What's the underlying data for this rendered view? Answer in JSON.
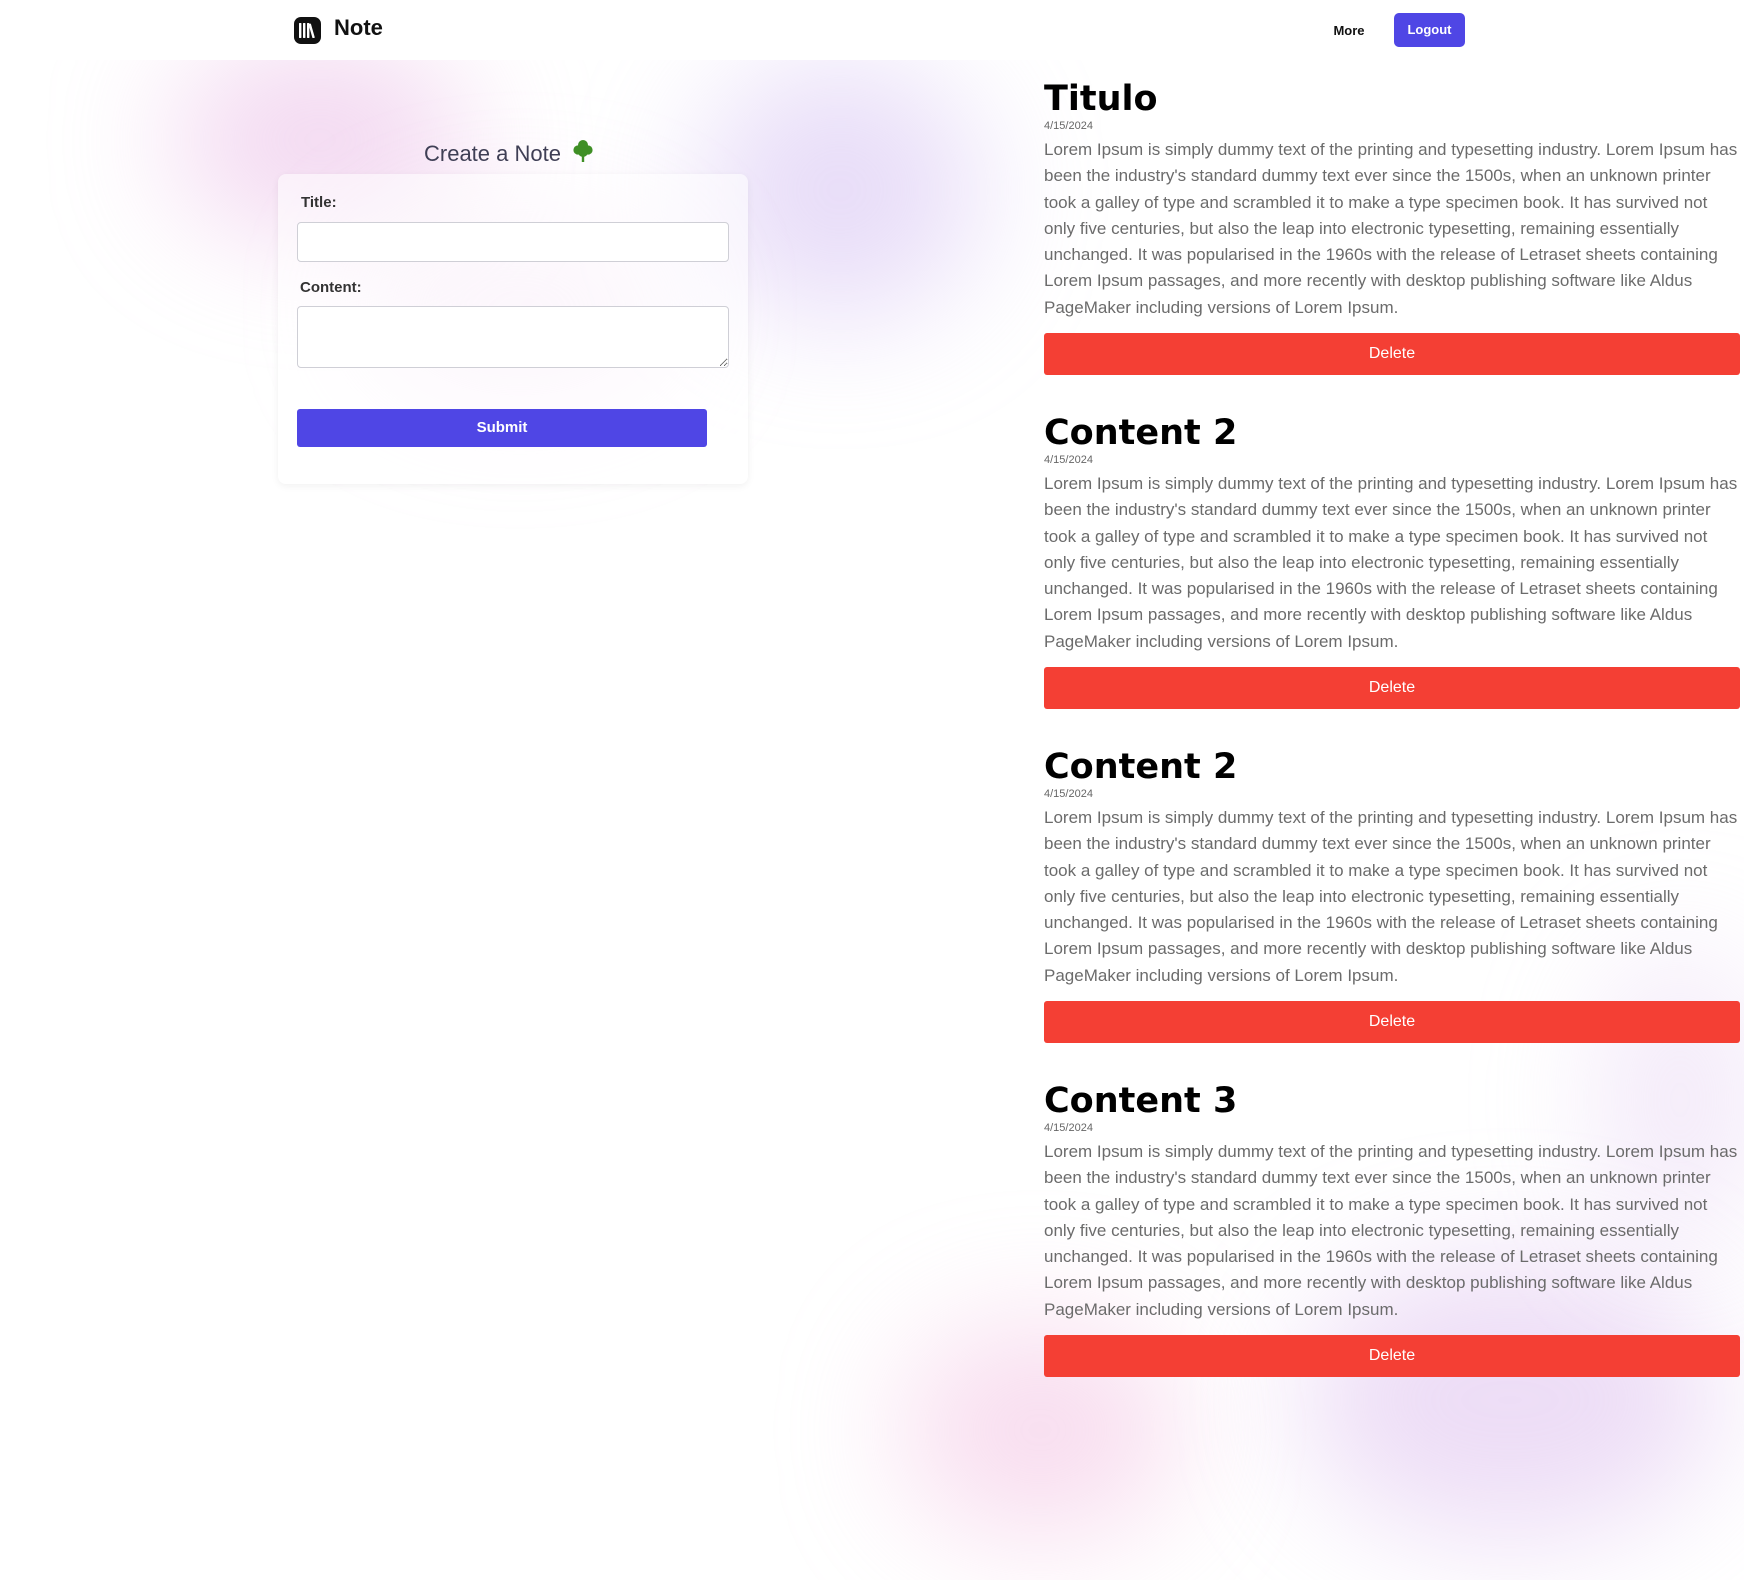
{
  "header": {
    "brand": "Note",
    "more_label": "More",
    "logout_label": "Logout"
  },
  "form": {
    "heading": "Create a Note",
    "title_label": "Title:",
    "content_label": "Content:",
    "title_value": "",
    "content_value": "",
    "submit_label": "Submit"
  },
  "notes": [
    {
      "title": "Titulo",
      "date": "4/15/2024",
      "content": "Lorem Ipsum is simply dummy text of the printing and typesetting industry. Lorem Ipsum has been the industry's standard dummy text ever since the 1500s, when an unknown printer took a galley of type and scrambled it to make a type specimen book. It has survived not only five centuries, but also the leap into electronic typesetting, remaining essentially unchanged. It was popularised in the 1960s with the release of Letraset sheets containing Lorem Ipsum passages, and more recently with desktop publishing software like Aldus PageMaker including versions of Lorem Ipsum.",
      "delete_label": "Delete"
    },
    {
      "title": "Content 2",
      "date": "4/15/2024",
      "content": "Lorem Ipsum is simply dummy text of the printing and typesetting industry. Lorem Ipsum has been the industry's standard dummy text ever since the 1500s, when an unknown printer took a galley of type and scrambled it to make a type specimen book. It has survived not only five centuries, but also the leap into electronic typesetting, remaining essentially unchanged. It was popularised in the 1960s with the release of Letraset sheets containing Lorem Ipsum passages, and more recently with desktop publishing software like Aldus PageMaker including versions of Lorem Ipsum.",
      "delete_label": "Delete"
    },
    {
      "title": "Content 2",
      "date": "4/15/2024",
      "content": "Lorem Ipsum is simply dummy text of the printing and typesetting industry. Lorem Ipsum has been the industry's standard dummy text ever since the 1500s, when an unknown printer took a galley of type and scrambled it to make a type specimen book. It has survived not only five centuries, but also the leap into electronic typesetting, remaining essentially unchanged. It was popularised in the 1960s with the release of Letraset sheets containing Lorem Ipsum passages, and more recently with desktop publishing software like Aldus PageMaker including versions of Lorem Ipsum.",
      "delete_label": "Delete"
    },
    {
      "title": "Content 3",
      "date": "4/15/2024",
      "content": "Lorem Ipsum is simply dummy text of the printing and typesetting industry. Lorem Ipsum has been the industry's standard dummy text ever since the 1500s, when an unknown printer took a galley of type and scrambled it to make a type specimen book. It has survived not only five centuries, but also the leap into electronic typesetting, remaining essentially unchanged. It was popularised in the 1960s with the release of Letraset sheets containing Lorem Ipsum passages, and more recently with desktop publishing software like Aldus PageMaker including versions of Lorem Ipsum.",
      "delete_label": "Delete"
    }
  ],
  "colors": {
    "primary": "#4f46e5",
    "danger": "#f43f34",
    "tree_icon": "#3f8f25"
  },
  "icons": {
    "logo": "books-icon",
    "heading": "tree-icon"
  }
}
